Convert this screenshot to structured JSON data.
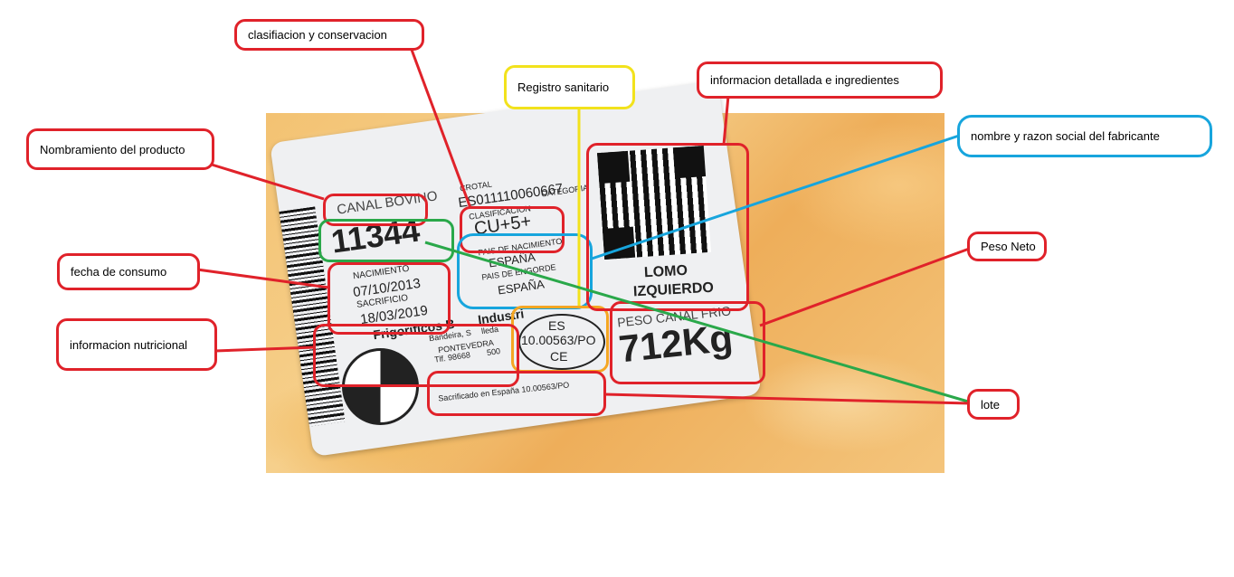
{
  "label": {
    "product_name": "CANAL BOVINO",
    "lot_number": "11344",
    "crotal_label": "CROTAL",
    "crotal_value": "ES011110060667",
    "category_label": "CATEGORIA",
    "classification_label": "CLASIFICACION",
    "classification_value": "CU+5+",
    "birth_country_label": "PAIS DE NACIMIENTO",
    "birth_country_value": "ESPAÑA",
    "fattening_country_label": "PAIS DE ENGORDE",
    "fattening_country_value": "ESPAÑA",
    "birth_label": "NACIMIENTO",
    "birth_date": "07/10/2013",
    "slaughter_label": "SACRIFICIO",
    "slaughter_date": "18/03/2019",
    "company_name": "Frigorificos B",
    "company_name_tail": "Industri",
    "address_line1": "Bandeira, S",
    "address_line1_tail": "lleda",
    "address_line2": "PONTEVEDRA",
    "phone": "Tlf. 98668",
    "phone_tail": "500",
    "health_mark_line1": "ES",
    "health_mark_line2": "10.00563/PO",
    "health_mark_line3": "CE",
    "qr_caption_line1": "LOMO",
    "qr_caption_line2": "IZQUIERDO",
    "weight_label": "PESO CANAL FRIO",
    "weight_value": "712Kg",
    "slaughtered_in": "Sacrificado en España 10.00563/PO"
  },
  "callouts": {
    "classification": "clasifiacion y conservacion",
    "health_registry": "Registro sanitario",
    "detailed_info": "informacion detallada e ingredientes",
    "product_naming": "Nombramiento del producto",
    "manufacturer": "nombre y razon social del fabricante",
    "consumption_date": "fecha de consumo",
    "net_weight": "Peso Neto",
    "nutrition": "informacion nutricional",
    "lot": "lote"
  },
  "colors": {
    "red": "#e0222a",
    "yellow": "#f2e21c",
    "blue": "#17a5dd",
    "green": "#2aa84a",
    "orange": "#f5a623"
  }
}
